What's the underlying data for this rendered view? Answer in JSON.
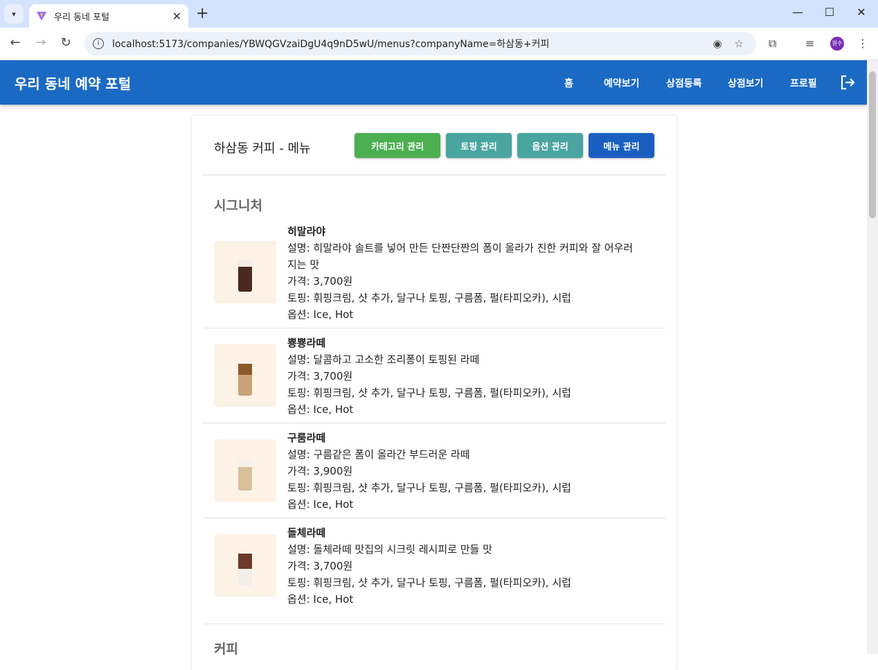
{
  "browser": {
    "tab_title": "우리 동네 포털",
    "url": "localhost:5173/companies/YBWQGVzaiDgU4q9nD5wU/menus?companyName=하삼동+커피",
    "avatar_text": "원수"
  },
  "appbar": {
    "brand": "우리 동네 예약 포털",
    "nav": [
      "홈",
      "예약보기",
      "상점등록",
      "상점보기",
      "프로필"
    ]
  },
  "page": {
    "title": "하삼동 커피 - 메뉴",
    "buttons": {
      "category": "카테고리 관리",
      "topping": "토핑 관리",
      "option": "옵션 관리",
      "menu": "메뉴 관리"
    },
    "colors": {
      "category": "#4caf50",
      "topping": "#4aa5a0",
      "option": "#4aa5a0",
      "menu": "#1a5fc0"
    }
  },
  "categories": [
    {
      "name": "시그니처",
      "items": [
        {
          "name": "히말라야",
          "desc_1": "설명: 히말라야 솔트를 넣어 만든 단짠단짠의 폼이 올라가 진한 커피와 잘 어우러",
          "desc_2": "지는 맛",
          "price": "가격: 3,700원",
          "toppings": "토핑: 휘핑크림, 샷 추가, 달구나 토핑, 구름폼, 펄(타피오카), 시럽",
          "options": "옵션: Ice, Hot"
        },
        {
          "name": "뿅뿅라떼",
          "desc_1": "설명: 달콤하고 고소한 조리퐁이 토핑된 라떼",
          "price": "가격: 3,700원",
          "toppings": "토핑: 휘핑크림, 샷 추가, 달구나 토핑, 구름폼, 펄(타피오카), 시럽",
          "options": "옵션: Ice, Hot"
        },
        {
          "name": "구룸라떼",
          "desc_1": "설명: 구름같은 폼이 올라간 부드러운 라떼",
          "price": "가격: 3,900원",
          "toppings": "토핑: 휘핑크림, 샷 추가, 달구나 토핑, 구름폼, 펄(타피오카), 시럽",
          "options": "옵션: Ice, Hot"
        },
        {
          "name": "돌체라떼",
          "desc_1": "설명: 돌체라떼 맛집의 시크릿 레시피로 만들 맛",
          "price": "가격: 3,700원",
          "toppings": "토핑: 휘핑크림, 샷 추가, 달구나 토핑, 구름폼, 펄(타피오카), 시럽",
          "options": "옵션: Ice, Hot"
        }
      ]
    },
    {
      "name": "커피"
    }
  ]
}
